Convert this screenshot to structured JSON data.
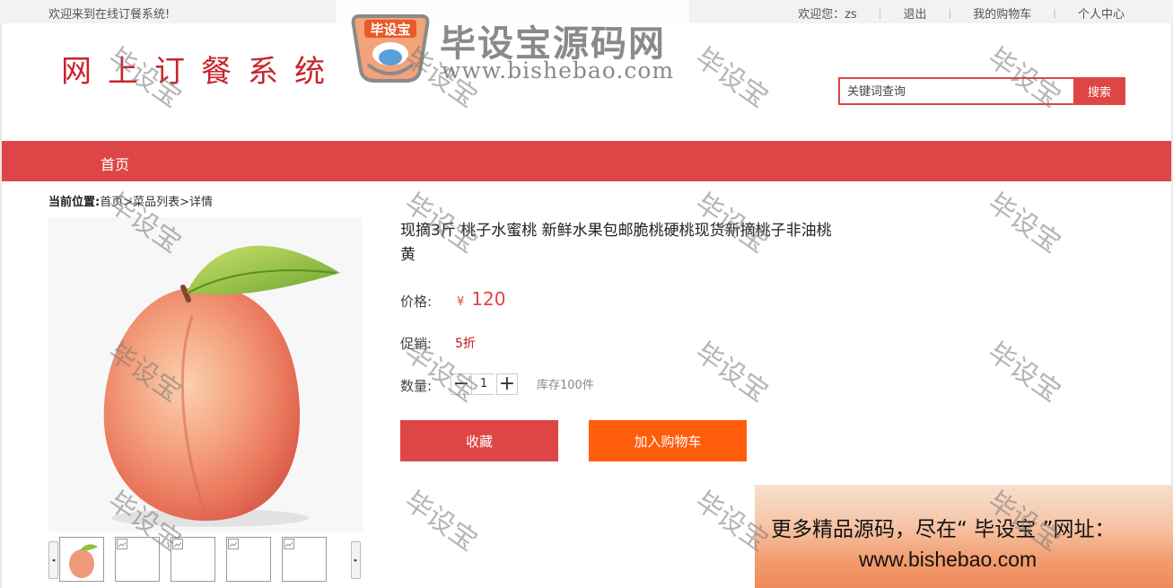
{
  "topbar": {
    "welcome": "欢迎来到在线订餐系统!",
    "user_greeting": "欢迎您：zs",
    "logout": "退出",
    "cart": "我的购物车",
    "profile": "个人中心"
  },
  "header": {
    "logo_text": "网上订餐系统",
    "watermark_name": "毕设宝源码网",
    "watermark_url": "www.bishebao.com",
    "watermark_badge": "毕设宝"
  },
  "search": {
    "placeholder": "关键词查询",
    "button": "搜索"
  },
  "nav": {
    "items": [
      "首页"
    ]
  },
  "breadcrumb": {
    "label": "当前位置:",
    "home": "首页",
    "list": "菜品列表",
    "current": "详情",
    "sep": ">"
  },
  "product": {
    "title": "现摘3斤 桃子水蜜桃 新鲜水果包邮脆桃硬桃现货新摘桃子非油桃黄",
    "price_label": "价格:",
    "currency": "¥",
    "price": "120",
    "promo_label": "促销:",
    "promo_value": "5折",
    "qty_label": "数量:",
    "qty_dec": "−",
    "quantity": "1",
    "qty_inc": "+",
    "stock": "库存100件",
    "favorite_button": "收藏",
    "cart_button": "加入购物车"
  },
  "watermark": {
    "stamp": "毕设宝"
  },
  "ad": {
    "line1": "更多精品源码，尽在“ 毕设宝 ”网址：",
    "line2": "www.bishebao.com"
  },
  "colors": {
    "accent": "#de4545",
    "cart_orange": "#ff5c0b"
  }
}
